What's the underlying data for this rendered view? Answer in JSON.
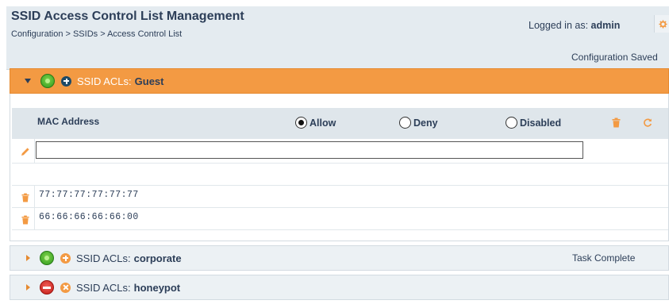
{
  "header": {
    "title": "SSID Access Control List Management",
    "breadcrumb": "Configuration > SSIDs > Access Control List",
    "logged_in_prefix": "Logged in as:",
    "username": "admin",
    "status": "Configuration Saved"
  },
  "panels": [
    {
      "label": "SSID ACLs:",
      "name": "Guest",
      "state": "enabled",
      "expanded": true
    },
    {
      "label": "SSID ACLs:",
      "name": "corporate",
      "state": "enabled",
      "expanded": false,
      "message": "Task Complete"
    },
    {
      "label": "SSID ACLs:",
      "name": "honeypot",
      "state": "disabled",
      "expanded": false
    }
  ],
  "acl": {
    "column_mac": "MAC Address",
    "options": [
      "Allow",
      "Deny",
      "Disabled"
    ],
    "selected": "Allow",
    "input_value": "",
    "entries": [
      "77:77:77:77:77:77",
      "66:66:66:66:66:00"
    ]
  },
  "colors": {
    "accent": "#f39a43",
    "header_bg": "#e4ebf0",
    "text": "#2c3e58",
    "enabled": "#2f9a1c",
    "disabled": "#c21a14"
  },
  "icons": [
    "gear-icon",
    "trash-icon",
    "refresh-icon",
    "pencil-icon",
    "status-enabled-icon",
    "status-disabled-icon",
    "add-icon",
    "remove-icon"
  ]
}
